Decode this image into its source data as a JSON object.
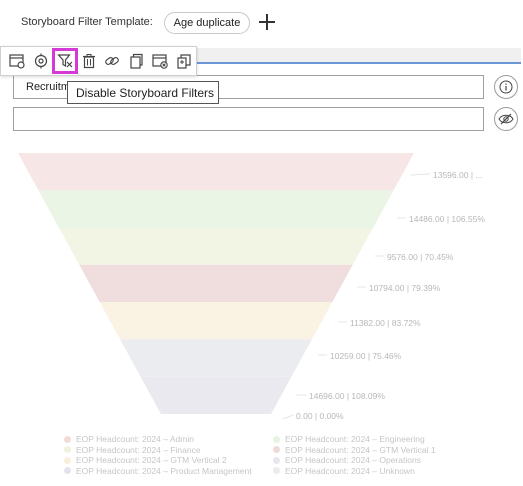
{
  "header": {
    "template_label": "Storyboard Filter Template:",
    "template_value": "Age duplicate"
  },
  "toolbar": {
    "items": [
      {
        "name": "settings-window-icon"
      },
      {
        "name": "target-refresh-icon"
      },
      {
        "name": "disable-filter-icon"
      },
      {
        "name": "trash-icon"
      },
      {
        "name": "link-icon"
      },
      {
        "name": "copy-icon"
      },
      {
        "name": "window-close-icon"
      },
      {
        "name": "duplicate-pages-icon"
      }
    ],
    "tooltip": "Disable Storyboard Filters"
  },
  "fields": {
    "field1_value": "Recruitme"
  },
  "chart_data": {
    "type": "funnel",
    "labels": [
      "13596.00 | ...",
      "14486.00 | 106.55%",
      "9576.00 | 70.45%",
      "10794.00 | 79.39%",
      "11382.00 | 83.72%",
      "10259.00 | 75.46%",
      "14696.00 | 108.09%",
      "0.00 | 0.00%"
    ],
    "values": [
      13596,
      14486,
      9576,
      10794,
      11382,
      10259,
      14696,
      0
    ],
    "colors": [
      "#f6e6e6",
      "#eaf5e6",
      "#f2f5e4",
      "#f0dede",
      "#faf3e3",
      "#ebecf0",
      "#eae9f0",
      "#f2f2f2"
    ],
    "legend": [
      {
        "label": "EOP Headcount: 2024 – Admin",
        "color": "#f2dada"
      },
      {
        "label": "EOP Headcount: 2024 – Engineering",
        "color": "#e8f2e2"
      },
      {
        "label": "EOP Headcount: 2024 – Finance",
        "color": "#f0f2dc"
      },
      {
        "label": "EOP Headcount: 2024 – GTM Vertical 1",
        "color": "#eedada"
      },
      {
        "label": "EOP Headcount: 2024 – GTM Vertical 2",
        "color": "#f8f0dc"
      },
      {
        "label": "EOP Headcount: 2024 – Operations",
        "color": "#e6e8ee"
      },
      {
        "label": "EOP Headcount: 2024 – Product Management",
        "color": "#e4e2ee"
      },
      {
        "label": "EOP Headcount: 2024 – Unknown",
        "color": "#ececec"
      }
    ]
  }
}
